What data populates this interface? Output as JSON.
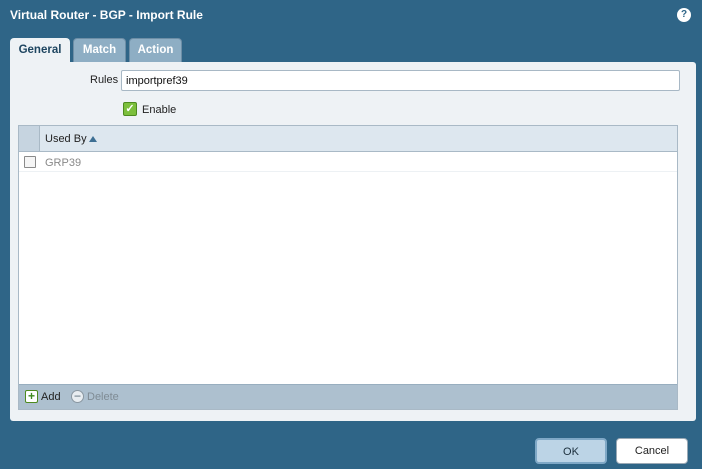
{
  "dialog": {
    "title": "Virtual Router - BGP - Import Rule",
    "help_icon": "?"
  },
  "tabs": [
    {
      "label": "General",
      "active": true
    },
    {
      "label": "Match",
      "active": false
    },
    {
      "label": "Action",
      "active": false
    }
  ],
  "form": {
    "rules_label": "Rules",
    "rules_value": "importpref39",
    "enable_label": "Enable",
    "enable_checked": true
  },
  "grid": {
    "column_header": "Used By",
    "sort": "ascending",
    "rows": [
      {
        "value": "GRP39",
        "checked": false
      }
    ],
    "add_label": "Add",
    "delete_label": "Delete"
  },
  "buttons": {
    "ok": "OK",
    "cancel": "Cancel"
  },
  "colors": {
    "dialog_bg": "#2f6587",
    "panel_bg": "#eef2f5",
    "tab_inactive": "#8eaec4",
    "enable_green": "#7cbf3c"
  }
}
